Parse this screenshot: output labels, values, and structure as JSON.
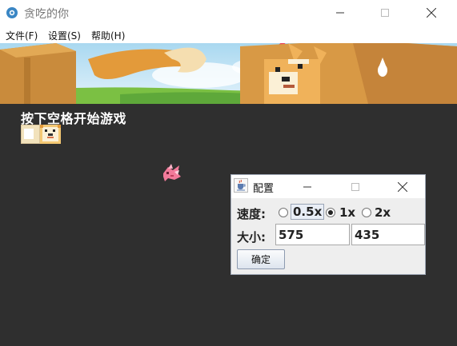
{
  "window": {
    "title": "贪吃的你",
    "controls": [
      "minimize-icon",
      "maximize-icon",
      "close-icon"
    ]
  },
  "menu": {
    "items": [
      {
        "label": "文件(F)"
      },
      {
        "label": "设置(S)"
      },
      {
        "label": "帮助(H)"
      }
    ]
  },
  "game": {
    "hint": "按下空格开始游戏",
    "background_color": "#2f2f2f",
    "snake_icons": [
      "snake-body-segment",
      "shiba-head-icon"
    ],
    "food_icon": "pink-bird-icon"
  },
  "dialog": {
    "title": "配置",
    "speed_label": "速度:",
    "speed_options": [
      {
        "label": "0.5x",
        "checked": false
      },
      {
        "label": "1x",
        "checked": true
      },
      {
        "label": "2x",
        "checked": false
      }
    ],
    "size_label": "大小:",
    "width_value": "575",
    "height_value": "435",
    "ok_label": "确定"
  },
  "colors": {
    "game_bg": "#2f2f2f",
    "dialog_bg": "#eeeeee",
    "sky": "#bfe3f5"
  }
}
